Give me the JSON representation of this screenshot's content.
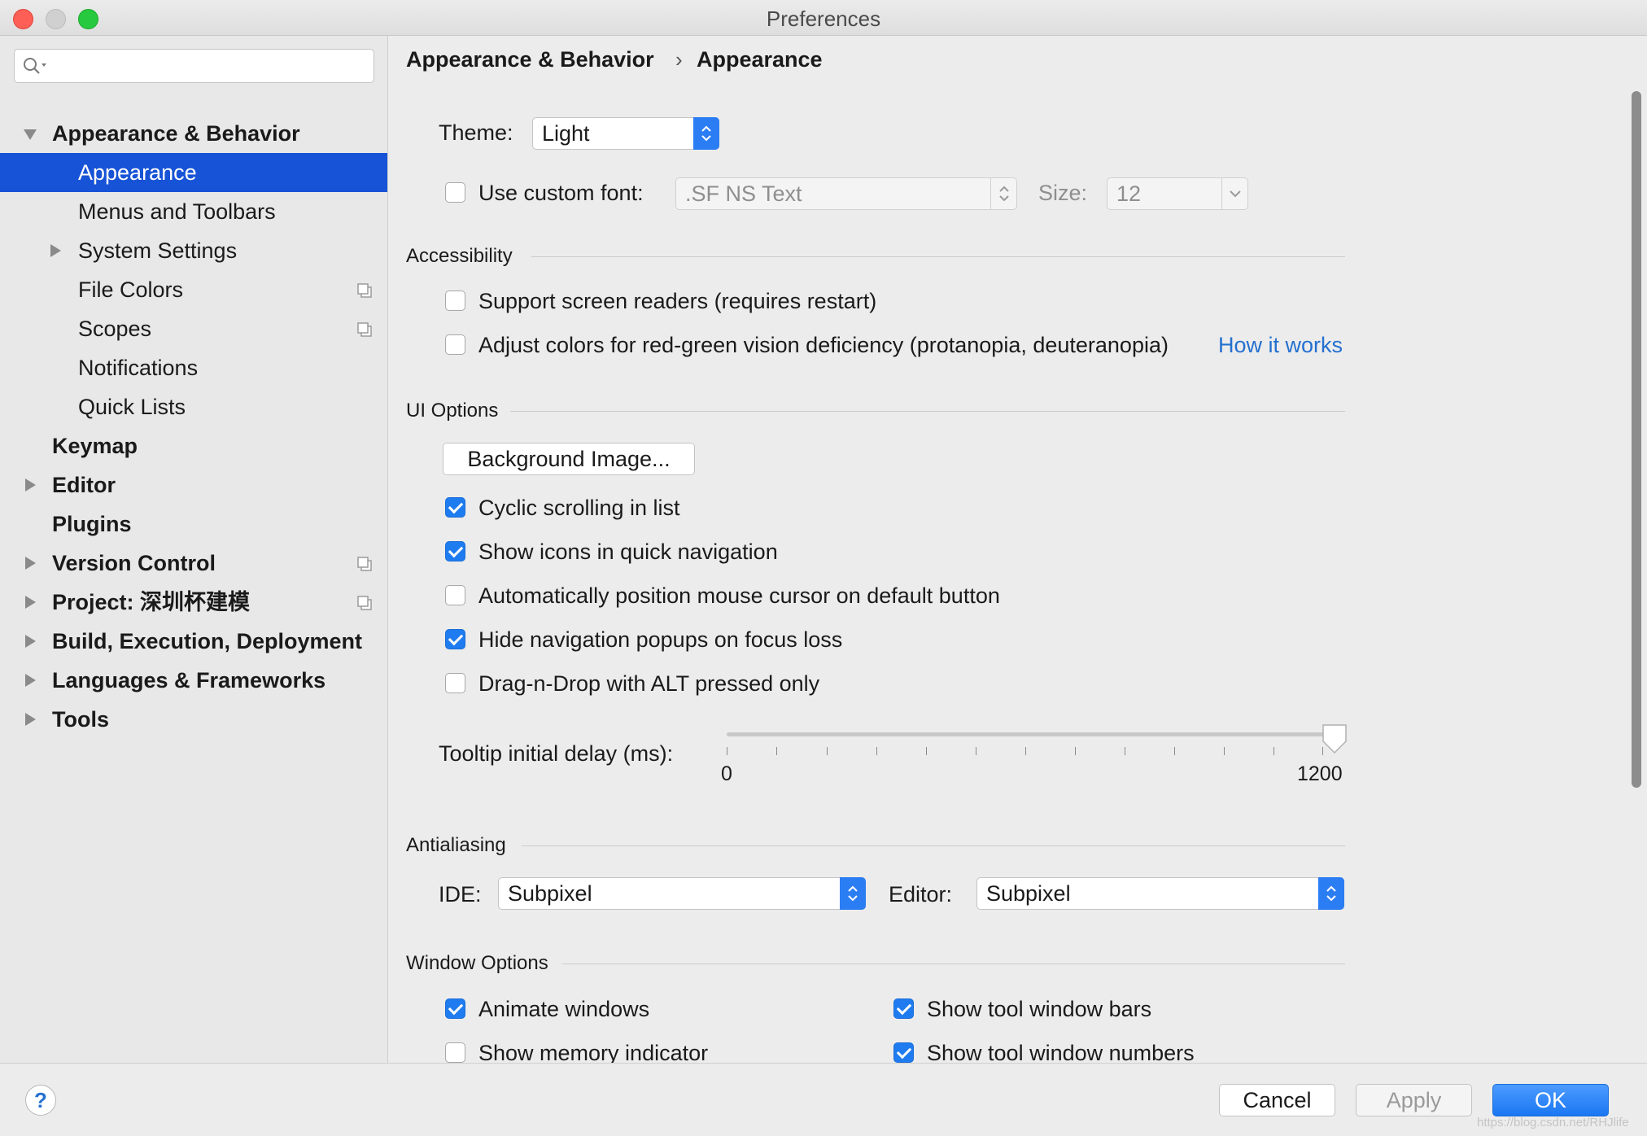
{
  "window": {
    "title": "Preferences"
  },
  "sidebar": {
    "search": {
      "placeholder": "",
      "value": ""
    },
    "items": [
      {
        "label": "Appearance & Behavior"
      },
      {
        "label": "Appearance"
      },
      {
        "label": "Menus and Toolbars"
      },
      {
        "label": "System Settings"
      },
      {
        "label": "File Colors"
      },
      {
        "label": "Scopes"
      },
      {
        "label": "Notifications"
      },
      {
        "label": "Quick Lists"
      },
      {
        "label": "Keymap"
      },
      {
        "label": "Editor"
      },
      {
        "label": "Plugins"
      },
      {
        "label": "Version Control"
      },
      {
        "label": "Project: 深圳杯建模"
      },
      {
        "label": "Build, Execution, Deployment"
      },
      {
        "label": "Languages & Frameworks"
      },
      {
        "label": "Tools"
      }
    ],
    "selected": "Appearance"
  },
  "breadcrumb": {
    "parent": "Appearance & Behavior",
    "separator": "›",
    "current": "Appearance"
  },
  "theme": {
    "label": "Theme:",
    "value": "Light"
  },
  "custom_font": {
    "label": "Use custom font:",
    "checked": false,
    "font": ".SF NS Text",
    "size_label": "Size:",
    "size": "12"
  },
  "accessibility": {
    "title": "Accessibility",
    "options": [
      {
        "label": "Support screen readers (requires restart)",
        "checked": false
      },
      {
        "label": "Adjust colors for red-green vision deficiency (protanopia, deuteranopia)",
        "checked": false
      }
    ],
    "link": "How it works"
  },
  "ui_options": {
    "title": "UI Options",
    "background_button": "Background Image...",
    "options": [
      {
        "label": "Cyclic scrolling in list",
        "checked": true
      },
      {
        "label": "Show icons in quick navigation",
        "checked": true
      },
      {
        "label": "Automatically position mouse cursor on default button",
        "checked": false
      },
      {
        "label": "Hide navigation popups on focus loss",
        "checked": true
      },
      {
        "label": "Drag-n-Drop with ALT pressed only",
        "checked": false
      }
    ],
    "tooltip_label": "Tooltip initial delay (ms):",
    "tooltip_min": "0",
    "tooltip_max": "1200",
    "tooltip_value": 1200
  },
  "antialiasing": {
    "title": "Antialiasing",
    "ide_label": "IDE:",
    "ide_value": "Subpixel",
    "editor_label": "Editor:",
    "editor_value": "Subpixel"
  },
  "window_options": {
    "title": "Window Options",
    "options": [
      {
        "label": "Animate windows",
        "checked": true
      },
      {
        "label": "Show tool window bars",
        "checked": true
      },
      {
        "label": "Show memory indicator",
        "checked": false
      },
      {
        "label": "Show tool window numbers",
        "checked": true
      }
    ]
  },
  "footer": {
    "help": "?",
    "cancel": "Cancel",
    "apply": "Apply",
    "ok": "OK",
    "watermark": "https://blog.csdn.net/RHJlife"
  },
  "colors": {
    "accent": "#1f7cf0",
    "selection": "#1753d6",
    "link": "#2470d0"
  }
}
